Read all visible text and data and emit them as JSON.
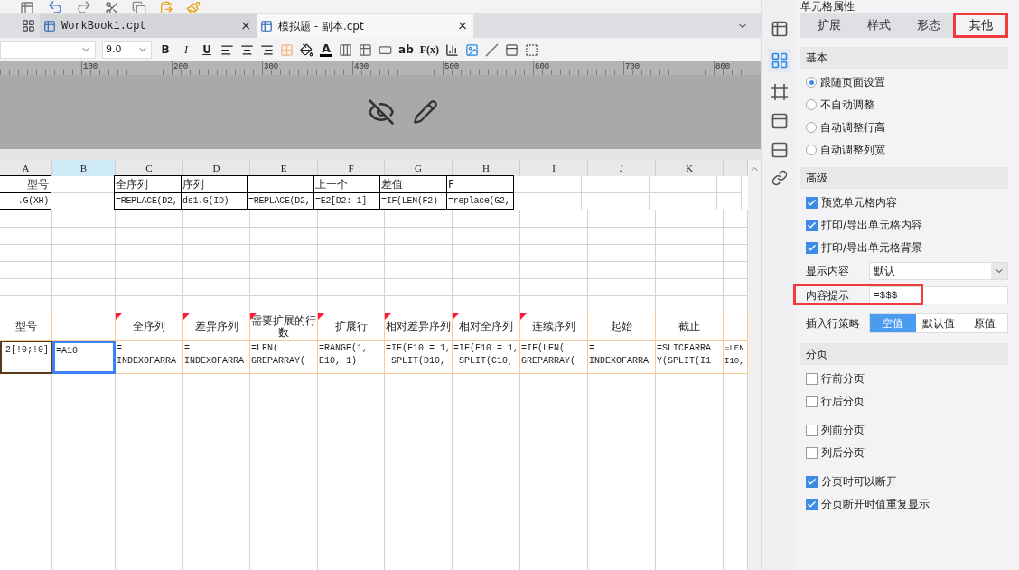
{
  "tabs": [
    {
      "label": "WorkBook1.cpt",
      "selected": false,
      "close": "×"
    },
    {
      "label": "模拟题 - 副本.cpt",
      "selected": true,
      "close": "×"
    }
  ],
  "format_bar": {
    "font_size": "9.0",
    "bold": "B",
    "italic": "I",
    "underline": "U",
    "font_color": "A",
    "text_tool": "ab",
    "formula": "F(x)"
  },
  "ruler": {
    "labels": [
      "100",
      "200",
      "300",
      "400",
      "500",
      "600",
      "700",
      "800"
    ]
  },
  "sheet": {
    "columns": [
      "A",
      "B",
      "C",
      "D",
      "E",
      "F",
      "G",
      "H",
      "I",
      "J",
      "K"
    ],
    "rows": [
      {
        "kind": "data",
        "cells": [
          {
            "text": "型号",
            "boxed": true,
            "selected": false
          },
          {
            "selected": false
          },
          {
            "text": "全序列",
            "boxed": true,
            "selected": false
          },
          {
            "text": "序列",
            "boxed": true,
            "selected": false
          },
          {
            "boxed": true,
            "selected": false
          },
          {
            "text": "上一个",
            "boxed": true,
            "selected": false
          },
          {
            "text": "差值",
            "boxed": true,
            "selected": false
          },
          {
            "text": "F",
            "boxed": true,
            "selected": false
          }
        ]
      },
      {
        "kind": "data",
        "cells": [
          {
            "text": ".G(XH)",
            "boxed": true,
            "selected": false
          },
          {
            "selected": false
          },
          {
            "text": "=REPLACE(D2,",
            "boxed": true,
            "selected": false
          },
          {
            "text": "ds1.G(ID)",
            "boxed": true,
            "selected": false
          },
          {
            "text": "=REPLACE(D2,",
            "boxed": true,
            "selected": false
          },
          {
            "text": "=E2[D2:-1]",
            "boxed": true,
            "selected": false
          },
          {
            "text": "=IF(LEN(F2)",
            "boxed": true,
            "selected": false
          },
          {
            "text": "=replace(G2,",
            "boxed": true,
            "selected": false
          }
        ]
      },
      {
        "kind": "blank"
      },
      {
        "kind": "blank"
      },
      {
        "kind": "blank"
      },
      {
        "kind": "blank"
      },
      {
        "kind": "blank"
      },
      {
        "kind": "blank"
      },
      {
        "kind": "header",
        "cells": [
          {
            "text": "型号",
            "flagged": false,
            "selected": false
          },
          {
            "flagged": false,
            "selected": false
          },
          {
            "text": "全序列",
            "flagged": true,
            "selected": false
          },
          {
            "text": "差异序列",
            "flagged": true,
            "selected": false
          },
          {
            "text": "需要扩展的行数",
            "flagged": true,
            "selected": false
          },
          {
            "text": "扩展行",
            "flagged": true,
            "selected": false
          },
          {
            "text": "相对差异序列",
            "flagged": true,
            "selected": false
          },
          {
            "text": "相对全序列",
            "flagged": true,
            "selected": false
          },
          {
            "text": "连续序列",
            "flagged": true,
            "selected": false
          },
          {
            "text": "起始",
            "flagged": false,
            "selected": false
          },
          {
            "text": "截止",
            "flagged": false,
            "selected": false
          }
        ]
      },
      {
        "kind": "formula",
        "cells": [
          {
            "text": "2[!0;!0]",
            "selected": false
          },
          {
            "text": "=A10",
            "selected": true
          },
          {
            "text": "=\nINDEXOFARRA",
            "selected": false
          },
          {
            "text": "=\nINDEXOFARRA",
            "selected": false
          },
          {
            "text": "=LEN(\nGREPARRAY(",
            "selected": false
          },
          {
            "text": "=RANGE(1,\nE10, 1)",
            "selected": false
          },
          {
            "text": "=IF(F10 = 1,\n SPLIT(D10,",
            "selected": false
          },
          {
            "text": "=IF(F10 = 1,\n SPLIT(C10,",
            "selected": false
          },
          {
            "text": "=IF(LEN(\nGREPARRAY(",
            "selected": false
          },
          {
            "text": "=\nINDEXOFARRA",
            "selected": false
          },
          {
            "text": "=SLICEARRA\nY(SPLIT(I1",
            "selected": false
          },
          {
            "text": "=LEN\nI10,",
            "selected": false
          }
        ]
      }
    ]
  },
  "panel": {
    "title": "单元格属性",
    "tabs": [
      {
        "label": "扩展",
        "selected": false,
        "highlighted": false
      },
      {
        "label": "样式",
        "selected": false,
        "highlighted": false
      },
      {
        "label": "形态",
        "selected": false,
        "highlighted": false
      },
      {
        "label": "其他",
        "selected": true,
        "highlighted": true
      }
    ],
    "sections": [
      {
        "title": "基本",
        "groups": [
          [
            {
              "kind": "radio",
              "label": "跟随页面设置",
              "selected": true
            },
            {
              "kind": "radio",
              "label": "不自动调整",
              "selected": false
            },
            {
              "kind": "radio",
              "label": "自动调整行高",
              "selected": false
            },
            {
              "kind": "radio",
              "label": "自动调整列宽",
              "selected": false
            }
          ]
        ]
      },
      {
        "title": "高级",
        "groups": [
          [
            {
              "kind": "checkbox",
              "label": "预览单元格内容",
              "checked": true
            },
            {
              "kind": "checkbox",
              "label": "打印/导出单元格内容",
              "checked": true
            },
            {
              "kind": "checkbox",
              "label": "打印/导出单元格背景",
              "checked": true
            },
            {
              "kind": "select",
              "label": "显示内容",
              "value": "默认"
            },
            {
              "kind": "field",
              "label": "内容提示",
              "value": "=$$$",
              "highlighted": true
            },
            {
              "kind": "segmented",
              "label": "插入行策略",
              "options": [
                {
                  "label": "空值",
                  "selected": true
                },
                {
                  "label": "默认值",
                  "selected": false
                },
                {
                  "label": "原值",
                  "selected": false
                }
              ]
            }
          ]
        ]
      },
      {
        "title": "分页",
        "groups": [
          [
            {
              "kind": "checkbox",
              "label": "行前分页",
              "checked": false
            },
            {
              "kind": "checkbox",
              "label": "行后分页",
              "checked": false
            }
          ],
          [
            {
              "kind": "checkbox",
              "label": "列前分页",
              "checked": false
            },
            {
              "kind": "checkbox",
              "label": "列后分页",
              "checked": false
            }
          ],
          [
            {
              "kind": "checkbox",
              "label": "分页时可以断开",
              "checked": true
            },
            {
              "kind": "checkbox",
              "label": "分页断开时值重复显示",
              "checked": true
            }
          ]
        ]
      }
    ]
  }
}
